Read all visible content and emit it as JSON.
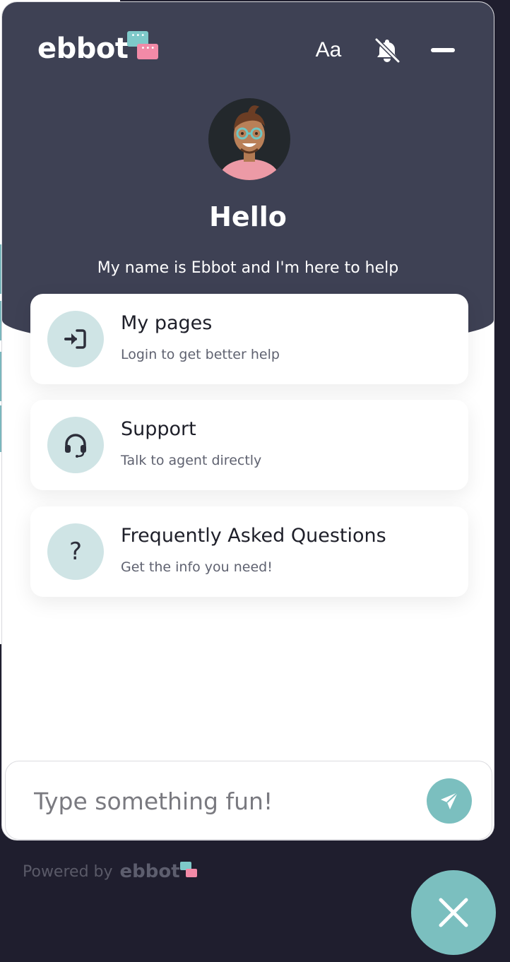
{
  "brand": {
    "name": "ebbot",
    "primary_color": "#3e4154",
    "accent_color": "#7bbfbf"
  },
  "header": {
    "font_button_label": "Aa",
    "bell_icon": "bell-off-icon",
    "minimize_icon": "minimize-icon",
    "greeting": "Hello",
    "subtitle": "My name is Ebbot and I'm here to help"
  },
  "cards": [
    {
      "title": "My pages",
      "subtitle": "Login to get better help",
      "icon": "login-icon"
    },
    {
      "title": "Support",
      "subtitle": "Talk to agent directly",
      "icon": "headset-icon"
    },
    {
      "title": "Frequently Asked Questions",
      "subtitle": "Get the info you need!",
      "icon": "question-icon",
      "icon_glyph": "?"
    }
  ],
  "input": {
    "placeholder": "Type something fun!",
    "value": ""
  },
  "footer": {
    "powered_by": "Powered by",
    "brand": "ebbot"
  }
}
